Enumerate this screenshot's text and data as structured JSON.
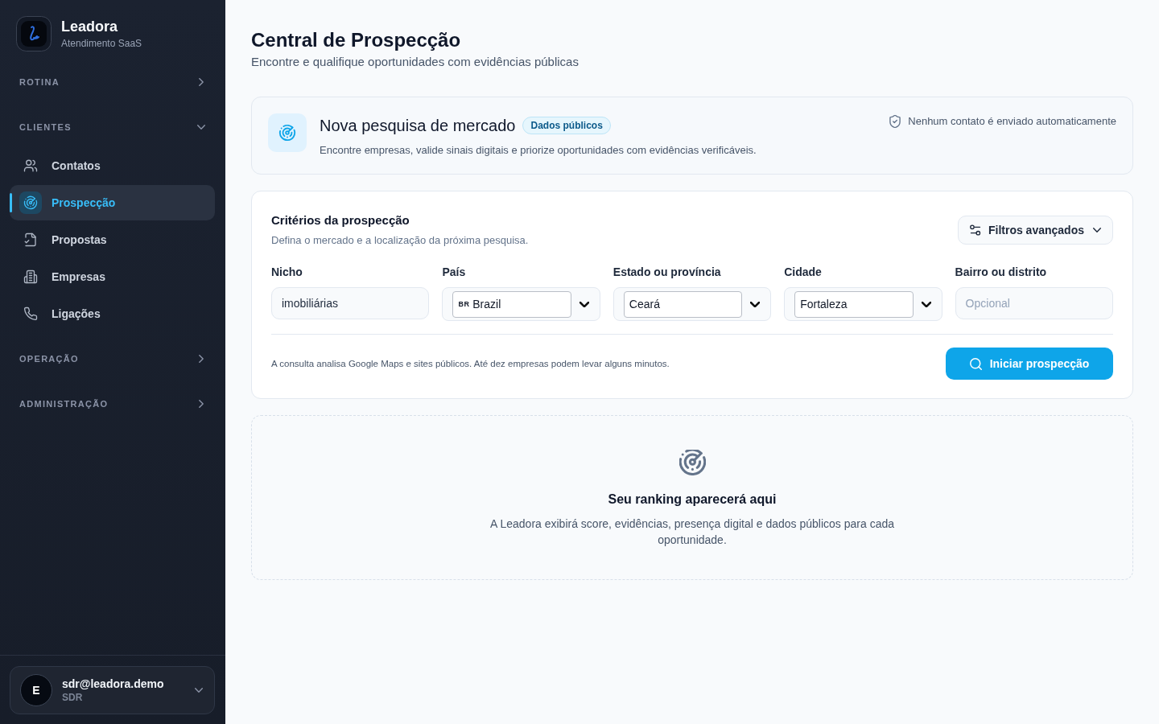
{
  "sidebar": {
    "brand": {
      "name": "Leadora",
      "subtitle": "Atendimento SaaS"
    },
    "sections": [
      {
        "label": "ROTINA",
        "expanded": false
      },
      {
        "label": "CLIENTES",
        "expanded": true,
        "items": [
          {
            "label": "Contatos",
            "selected": false
          },
          {
            "label": "Prospecção",
            "selected": true
          },
          {
            "label": "Propostas",
            "selected": false
          },
          {
            "label": "Empresas",
            "selected": false
          },
          {
            "label": "Ligações",
            "selected": false
          }
        ]
      },
      {
        "label": "OPERAÇÃO",
        "expanded": false
      },
      {
        "label": "ADMINISTRAÇÃO",
        "expanded": false
      }
    ],
    "user": {
      "initial": "E",
      "email": "sdr@leadora.demo",
      "role": "SDR"
    }
  },
  "header": {
    "title": "Central de Prospecção",
    "subtitle": "Encontre e qualifique oportunidades com evidências públicas"
  },
  "intro_card": {
    "title": "Nova pesquisa de mercado",
    "badge": "Dados públicos",
    "description": "Encontre empresas, valide sinais digitais e priorize oportunidades com evidências verificáveis.",
    "notice": "Nenhum contato é enviado automaticamente"
  },
  "criteria": {
    "title": "Critérios da prospecção",
    "subtitle": "Defina o mercado e a localização da próxima pesquisa.",
    "filters_button": "Filtros avançados",
    "fields": [
      {
        "kind": "text",
        "label": "Nicho",
        "value": "imobiliárias"
      },
      {
        "kind": "select",
        "label": "País",
        "flag": "BR",
        "value": "Brazil"
      },
      {
        "kind": "select",
        "label": "Estado ou província",
        "value": "Ceará"
      },
      {
        "kind": "select",
        "label": "Cidade",
        "value": "Fortaleza"
      },
      {
        "kind": "text",
        "label": "Bairro ou distrito",
        "placeholder": "Opcional"
      }
    ],
    "note": "A consulta analisa Google Maps e sites públicos. Até dez empresas podem levar alguns minutos.",
    "submit_button": "Iniciar prospecção"
  },
  "empty_state": {
    "title": "Seu ranking aparecerá aqui",
    "description": "A Leadora exibirá score, evidências, presença digital e dados públicos para cada oportunidade."
  }
}
